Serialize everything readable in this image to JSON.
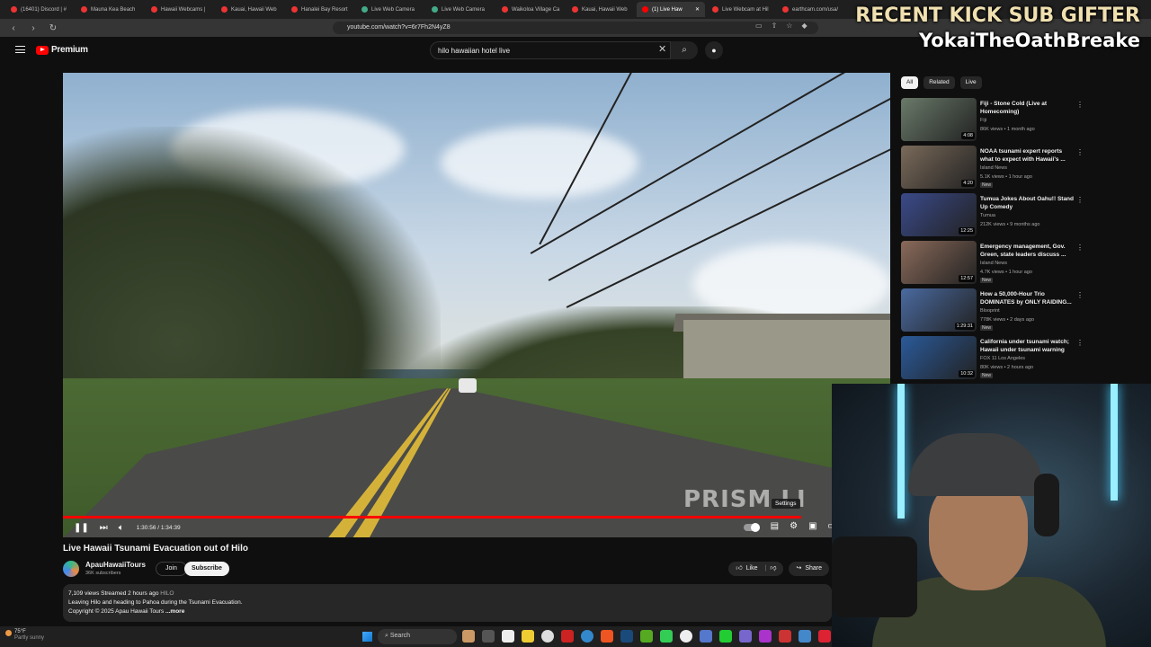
{
  "browser": {
    "tabs": [
      {
        "label": "(16401) Discord | #",
        "icon": "discord-icon",
        "active": false
      },
      {
        "label": "Mauna Kea Beach",
        "icon": "globe-icon",
        "active": false
      },
      {
        "label": "Hawaii Webcams |",
        "icon": "globe-icon",
        "active": false
      },
      {
        "label": "Kauai, Hawaii Web",
        "icon": "globe-icon",
        "active": false
      },
      {
        "label": "Hanalei Bay Resort",
        "icon": "globe-icon",
        "active": false
      },
      {
        "label": "Live Web Camera",
        "icon": "camera-icon",
        "active": false
      },
      {
        "label": "Live Web Camera",
        "icon": "camera-icon",
        "active": false
      },
      {
        "label": "Waikoloa Village Ca",
        "icon": "globe-icon",
        "active": false
      },
      {
        "label": "Kauai, Hawaii Web",
        "icon": "globe-icon",
        "active": false
      },
      {
        "label": "(1) Live Haw",
        "icon": "youtube-icon",
        "active": true
      },
      {
        "label": "Live Webcam at Hil",
        "icon": "globe-icon",
        "active": false
      },
      {
        "label": "earthcam.com/usa/",
        "icon": "globe-icon",
        "active": false
      }
    ],
    "url": "youtube.com/watch?v=6r7Fh2N4yZ8"
  },
  "youtube": {
    "logo_label": "Premium",
    "search_value": "hilo hawaiian hotel live"
  },
  "overlay": {
    "line1": "RECENT KICK SUB GIFTER",
    "line2": "YokaiTheOathBreake"
  },
  "player": {
    "time": "1:30:56 / 1:34:39",
    "settings_tooltip": "Settings",
    "watermark": "PRISM LI",
    "progress_fraction": 0.96
  },
  "video": {
    "title": "Live Hawaii Tsunami Evacuation out of Hilo",
    "channel": "ApauHawaiiTours",
    "subscribers": "36K subscribers",
    "join_label": "Join",
    "subscribe_label": "Subscribe",
    "like_label": "Like",
    "share_label": "Share",
    "stats": "7,109 views  Streamed 2 hours ago",
    "location_tag": "HILO",
    "description": "Leaving Hilo and heading to Pahoa during the Tsunami Evacuation.",
    "copyright": "Copyright © 2025 Apau Hawaii Tours",
    "more_label": "...more"
  },
  "sidebar": {
    "chips": [
      {
        "label": "All",
        "selected": true
      },
      {
        "label": "Related",
        "selected": false
      },
      {
        "label": "Live",
        "selected": false
      }
    ],
    "recommendations": [
      {
        "title": "Fiji - Stone Cold (Live at Homecoming)",
        "channel": "Fiji",
        "meta": "86K views • 1 month ago",
        "duration": "4:08",
        "badge": "",
        "thumb": "#6a7a6a"
      },
      {
        "title": "NOAA tsunami expert reports what to expect with Hawaii's ...",
        "channel": "Island News",
        "meta": "5.1K views • 1 hour ago",
        "duration": "4:20",
        "badge": "New",
        "thumb": "#7a6a5a"
      },
      {
        "title": "Tumua Jokes About Oahu!! Stand Up Comedy",
        "channel": "Tumua",
        "meta": "212K views • 9 months ago",
        "duration": "12:25",
        "badge": "",
        "thumb": "#3a4a8a"
      },
      {
        "title": "Emergency management, Gov. Green, state leaders discuss ...",
        "channel": "Island News",
        "meta": "4.7K views • 1 hour ago",
        "duration": "12:57",
        "badge": "New",
        "thumb": "#8a6a5a"
      },
      {
        "title": "How a 50,000-Hour Trio DOMINATES by ONLY RAIDING...",
        "channel": "Blooprint",
        "meta": "778K views • 2 days ago",
        "duration": "1:29:31",
        "badge": "New",
        "thumb": "#4a6aa0"
      },
      {
        "title": "California under tsunami watch; Hawaii under tsunami warning",
        "channel": "FOX 11 Los Angeles",
        "meta": "80K views • 2 hours ago",
        "duration": "10:32",
        "badge": "New",
        "thumb": "#2a5a9a"
      }
    ]
  },
  "taskbar": {
    "temperature": "75°F",
    "weather": "Partly sunny",
    "search_label": "Search",
    "notif_count": "1"
  }
}
